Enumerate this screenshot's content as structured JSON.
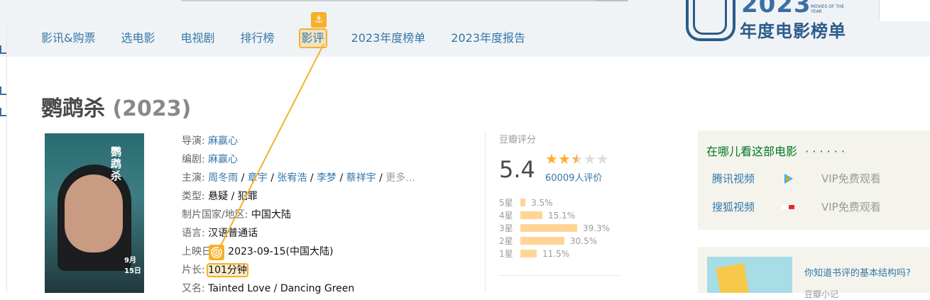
{
  "nav": {
    "items": [
      "影讯&购票",
      "选电影",
      "电视剧",
      "排行榜",
      "影评",
      "2023年度榜单",
      "2023年度报告"
    ]
  },
  "badge": {
    "year": "2023",
    "small": "MOVIES OF THE YEAR",
    "title": "年度电影榜单"
  },
  "movie": {
    "title": "鹦鹉杀",
    "year": "(2023)",
    "poster_text": "鹦鹉杀",
    "poster_date": "9月15日"
  },
  "info": {
    "director_label": "导演",
    "director": "麻赢心",
    "writer_label": "编剧",
    "writer": "麻赢心",
    "cast_label": "主演",
    "cast": [
      "周冬雨",
      "章宇",
      "张宥浩",
      "李梦",
      "蔡祥宇"
    ],
    "cast_more": "更多...",
    "genre_label": "类型",
    "genre": "悬疑 / 犯罪",
    "country_label": "制片国家/地区",
    "country": "中国大陆",
    "language_label": "语言",
    "language": "汉语普通话",
    "release_label": "上映日期",
    "release": "2023-09-15(中国大陆)",
    "runtime_label": "片长",
    "runtime": "101分钟",
    "aka_label": "又名",
    "aka": "Tainted Love / Dancing Green"
  },
  "rating": {
    "label": "豆瓣评分",
    "score": "5.4",
    "votes": "60009人评价",
    "stars_filled": 2.5,
    "distribution": [
      {
        "label": "5星",
        "pct": "3.5%",
        "value": 3.5
      },
      {
        "label": "4星",
        "pct": "15.1%",
        "value": 15.1
      },
      {
        "label": "3星",
        "pct": "39.3%",
        "value": 39.3
      },
      {
        "label": "2星",
        "pct": "30.5%",
        "value": 30.5
      },
      {
        "label": "1星",
        "pct": "11.5%",
        "value": 11.5
      }
    ]
  },
  "watch": {
    "title": "在哪儿看这部电影",
    "dots": "· · · · · ·",
    "providers": [
      {
        "name": "腾讯视频",
        "vip": "VIP免费观看",
        "icon": "tencent-video-icon"
      },
      {
        "name": "搜狐视频",
        "vip": "VIP免费观看",
        "icon": "sohu-video-icon"
      }
    ]
  },
  "promo": {
    "link": "你知道书评的基本结构吗?",
    "sub": "豆瓣小记"
  },
  "colors": {
    "link": "#3377aa",
    "highlight": "#f5b12b",
    "watch_green": "#007722",
    "bar": "#ffd596",
    "star": "#ffac2d"
  }
}
